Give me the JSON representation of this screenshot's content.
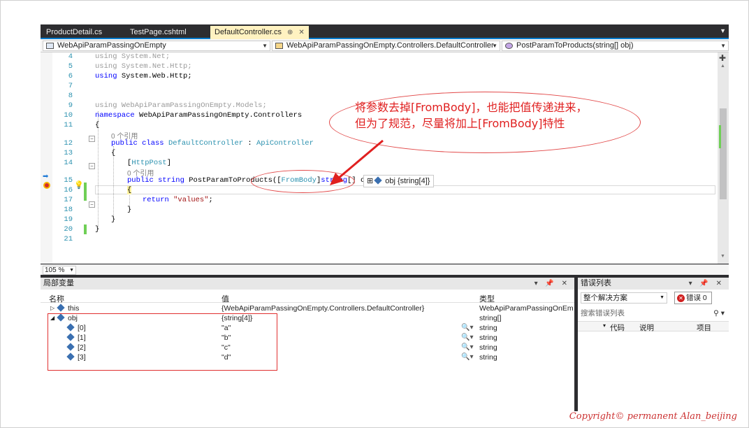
{
  "tabs": [
    {
      "label": "ProductDetail.cs"
    },
    {
      "label": "TestPage.cshtml"
    },
    {
      "label": "DefaultController.cs",
      "pin": "⊕",
      "close": "✕"
    }
  ],
  "nav": {
    "project": "WebApiParamPassingOnEmpty",
    "class": "WebApiParamPassingOnEmpty.Controllers.DefaultController",
    "member": "PostParamToProducts(string[] obj)"
  },
  "code_lines": [
    {
      "n": "4",
      "text": "using System.Net;"
    },
    {
      "n": "5",
      "text": "using System.Net.Http;"
    },
    {
      "n": "6",
      "text": "using System.Web.Http;"
    },
    {
      "n": "7",
      "text": ""
    },
    {
      "n": "8",
      "text": ""
    },
    {
      "n": "9",
      "text": "using WebApiParamPassingOnEmpty.Models;"
    },
    {
      "n": "10",
      "text": "namespace WebApiParamPassingOnEmpty.Controllers"
    },
    {
      "n": "11",
      "text": "{"
    },
    {
      "n": "",
      "text": "0 个引用"
    },
    {
      "n": "12",
      "text": "public class DefaultController : ApiController"
    },
    {
      "n": "13",
      "text": "{"
    },
    {
      "n": "14",
      "text": "[HttpPost]"
    },
    {
      "n": "",
      "text": "0 个引用"
    },
    {
      "n": "15",
      "text": "public string PostParamToProducts([FromBody]string[] obj)"
    },
    {
      "n": "16",
      "text": "{"
    },
    {
      "n": "17",
      "text": "return \"values\";"
    },
    {
      "n": "18",
      "text": "}"
    },
    {
      "n": "19",
      "text": "}"
    },
    {
      "n": "20",
      "text": "}"
    },
    {
      "n": "21",
      "text": ""
    }
  ],
  "datatip": "obj {string[4]}",
  "annotation": {
    "line1": "将参数去掉[FromBody]，也能把值传递进来，",
    "line2": "但为了规范，尽量将加上[FromBody]特性"
  },
  "zoom": "105 %",
  "locals": {
    "title": "局部变量",
    "buttons": "▾ 📌 ✕",
    "headers": {
      "name": "名称",
      "value": "值",
      "type": "类型"
    },
    "rows": [
      {
        "expand": "▷",
        "name": "this",
        "value": "{WebApiParamPassingOnEmpty.Controllers.DefaultController}",
        "type": "WebApiParamPassingOnEm"
      },
      {
        "expand": "◢",
        "name": "obj",
        "value": "{string[4]}",
        "type": "string[]"
      },
      {
        "expand": "",
        "name": "[0]",
        "value": "\"a\"",
        "type": "string"
      },
      {
        "expand": "",
        "name": "[1]",
        "value": "\"b\"",
        "type": "string"
      },
      {
        "expand": "",
        "name": "[2]",
        "value": "\"c\"",
        "type": "string"
      },
      {
        "expand": "",
        "name": "[3]",
        "value": "\"d\"",
        "type": "string"
      }
    ]
  },
  "errors": {
    "title": "错误列表",
    "buttons": "▾ 📌 ✕",
    "scope": "整个解决方案",
    "error_button": "错误 0",
    "search_placeholder": "搜索错误列表",
    "headers": {
      "code": "代码",
      "desc": "说明",
      "project": "项目"
    }
  },
  "copyright": "Copyright© permanent  Alan_beijing"
}
